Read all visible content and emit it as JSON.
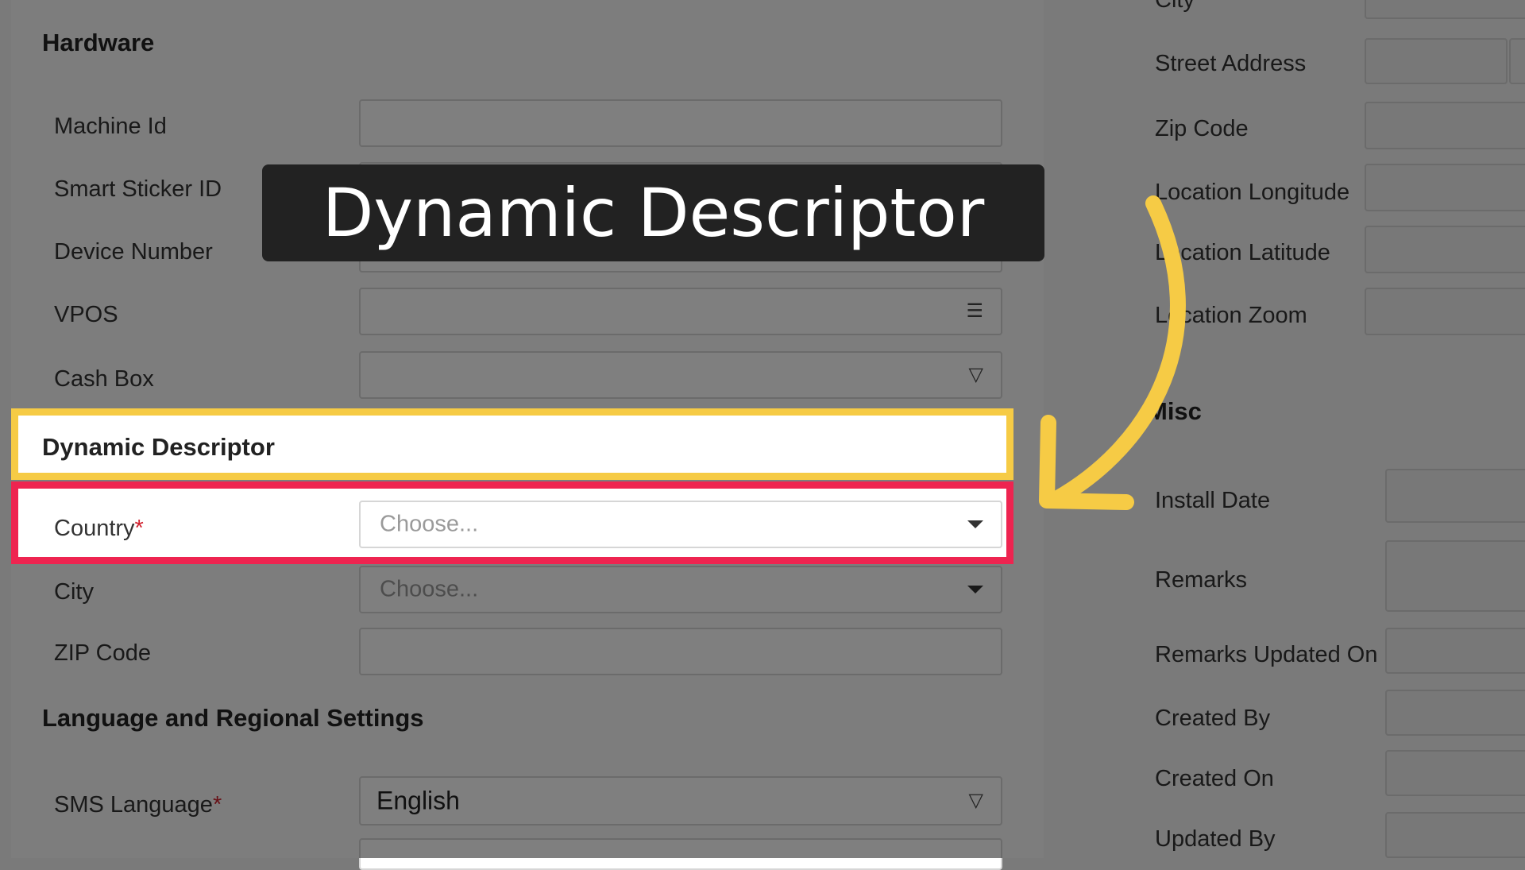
{
  "left": {
    "hardware_title": "Hardware",
    "fields": [
      {
        "label": "Machine Id"
      },
      {
        "label": "Smart Sticker ID"
      },
      {
        "label": "Device Number"
      },
      {
        "label": "VPOS"
      },
      {
        "label": "Cash Box"
      }
    ],
    "dynamic_title": "Dynamic Descriptor",
    "country": {
      "label": "Country",
      "required": "*",
      "placeholder": "Choose..."
    },
    "city": {
      "label": "City",
      "placeholder": "Choose..."
    },
    "zip": {
      "label": "ZIP Code"
    },
    "lang_title": "Language and Regional Settings",
    "sms_language": {
      "label": "SMS Language",
      "required": "*",
      "value": "English"
    }
  },
  "right": {
    "top_partial_label": "City",
    "fields": [
      {
        "label": "Street Address"
      },
      {
        "label": "Zip Code"
      },
      {
        "label": "Location Longitude"
      },
      {
        "label": "Location Latitude"
      },
      {
        "label": "Location Zoom"
      }
    ],
    "misc_title": "Misc",
    "misc_fields": [
      {
        "label": "Install Date"
      },
      {
        "label": "Remarks"
      },
      {
        "label": "Remarks Updated On"
      },
      {
        "label": "Created By"
      },
      {
        "label": "Created On"
      },
      {
        "label": "Updated By"
      }
    ]
  },
  "annotation": {
    "banner_text": "Dynamic Descriptor",
    "arrow_color": "#f6cb45",
    "yellow_highlight_color": "#f6cb45",
    "red_highlight_color": "#ee2450"
  }
}
